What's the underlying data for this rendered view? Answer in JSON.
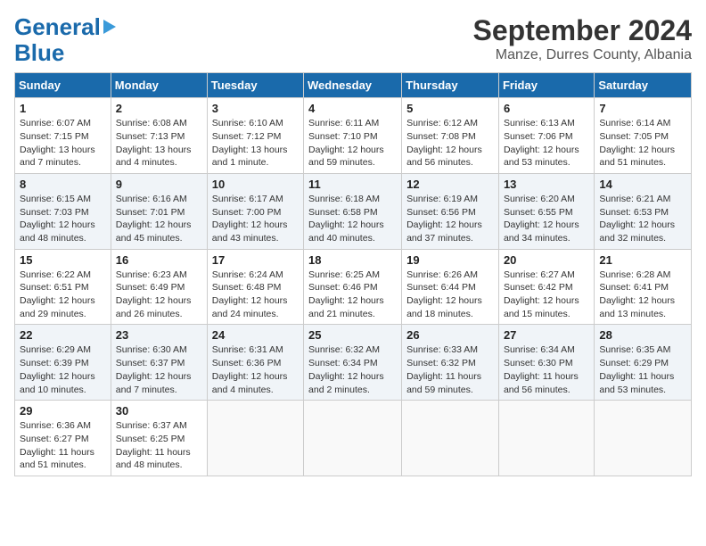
{
  "logo": {
    "line1": "General",
    "line2": "Blue",
    "tagline": ""
  },
  "title": "September 2024",
  "subtitle": "Manze, Durres County, Albania",
  "days": [
    "Sunday",
    "Monday",
    "Tuesday",
    "Wednesday",
    "Thursday",
    "Friday",
    "Saturday"
  ],
  "weeks": [
    [
      {
        "day": "1",
        "info": "Sunrise: 6:07 AM\nSunset: 7:15 PM\nDaylight: 13 hours\nand 7 minutes."
      },
      {
        "day": "2",
        "info": "Sunrise: 6:08 AM\nSunset: 7:13 PM\nDaylight: 13 hours\nand 4 minutes."
      },
      {
        "day": "3",
        "info": "Sunrise: 6:10 AM\nSunset: 7:12 PM\nDaylight: 13 hours\nand 1 minute."
      },
      {
        "day": "4",
        "info": "Sunrise: 6:11 AM\nSunset: 7:10 PM\nDaylight: 12 hours\nand 59 minutes."
      },
      {
        "day": "5",
        "info": "Sunrise: 6:12 AM\nSunset: 7:08 PM\nDaylight: 12 hours\nand 56 minutes."
      },
      {
        "day": "6",
        "info": "Sunrise: 6:13 AM\nSunset: 7:06 PM\nDaylight: 12 hours\nand 53 minutes."
      },
      {
        "day": "7",
        "info": "Sunrise: 6:14 AM\nSunset: 7:05 PM\nDaylight: 12 hours\nand 51 minutes."
      }
    ],
    [
      {
        "day": "8",
        "info": "Sunrise: 6:15 AM\nSunset: 7:03 PM\nDaylight: 12 hours\nand 48 minutes."
      },
      {
        "day": "9",
        "info": "Sunrise: 6:16 AM\nSunset: 7:01 PM\nDaylight: 12 hours\nand 45 minutes."
      },
      {
        "day": "10",
        "info": "Sunrise: 6:17 AM\nSunset: 7:00 PM\nDaylight: 12 hours\nand 43 minutes."
      },
      {
        "day": "11",
        "info": "Sunrise: 6:18 AM\nSunset: 6:58 PM\nDaylight: 12 hours\nand 40 minutes."
      },
      {
        "day": "12",
        "info": "Sunrise: 6:19 AM\nSunset: 6:56 PM\nDaylight: 12 hours\nand 37 minutes."
      },
      {
        "day": "13",
        "info": "Sunrise: 6:20 AM\nSunset: 6:55 PM\nDaylight: 12 hours\nand 34 minutes."
      },
      {
        "day": "14",
        "info": "Sunrise: 6:21 AM\nSunset: 6:53 PM\nDaylight: 12 hours\nand 32 minutes."
      }
    ],
    [
      {
        "day": "15",
        "info": "Sunrise: 6:22 AM\nSunset: 6:51 PM\nDaylight: 12 hours\nand 29 minutes."
      },
      {
        "day": "16",
        "info": "Sunrise: 6:23 AM\nSunset: 6:49 PM\nDaylight: 12 hours\nand 26 minutes."
      },
      {
        "day": "17",
        "info": "Sunrise: 6:24 AM\nSunset: 6:48 PM\nDaylight: 12 hours\nand 24 minutes."
      },
      {
        "day": "18",
        "info": "Sunrise: 6:25 AM\nSunset: 6:46 PM\nDaylight: 12 hours\nand 21 minutes."
      },
      {
        "day": "19",
        "info": "Sunrise: 6:26 AM\nSunset: 6:44 PM\nDaylight: 12 hours\nand 18 minutes."
      },
      {
        "day": "20",
        "info": "Sunrise: 6:27 AM\nSunset: 6:42 PM\nDaylight: 12 hours\nand 15 minutes."
      },
      {
        "day": "21",
        "info": "Sunrise: 6:28 AM\nSunset: 6:41 PM\nDaylight: 12 hours\nand 13 minutes."
      }
    ],
    [
      {
        "day": "22",
        "info": "Sunrise: 6:29 AM\nSunset: 6:39 PM\nDaylight: 12 hours\nand 10 minutes."
      },
      {
        "day": "23",
        "info": "Sunrise: 6:30 AM\nSunset: 6:37 PM\nDaylight: 12 hours\nand 7 minutes."
      },
      {
        "day": "24",
        "info": "Sunrise: 6:31 AM\nSunset: 6:36 PM\nDaylight: 12 hours\nand 4 minutes."
      },
      {
        "day": "25",
        "info": "Sunrise: 6:32 AM\nSunset: 6:34 PM\nDaylight: 12 hours\nand 2 minutes."
      },
      {
        "day": "26",
        "info": "Sunrise: 6:33 AM\nSunset: 6:32 PM\nDaylight: 11 hours\nand 59 minutes."
      },
      {
        "day": "27",
        "info": "Sunrise: 6:34 AM\nSunset: 6:30 PM\nDaylight: 11 hours\nand 56 minutes."
      },
      {
        "day": "28",
        "info": "Sunrise: 6:35 AM\nSunset: 6:29 PM\nDaylight: 11 hours\nand 53 minutes."
      }
    ],
    [
      {
        "day": "29",
        "info": "Sunrise: 6:36 AM\nSunset: 6:27 PM\nDaylight: 11 hours\nand 51 minutes."
      },
      {
        "day": "30",
        "info": "Sunrise: 6:37 AM\nSunset: 6:25 PM\nDaylight: 11 hours\nand 48 minutes."
      },
      {
        "day": "",
        "info": ""
      },
      {
        "day": "",
        "info": ""
      },
      {
        "day": "",
        "info": ""
      },
      {
        "day": "",
        "info": ""
      },
      {
        "day": "",
        "info": ""
      }
    ]
  ]
}
